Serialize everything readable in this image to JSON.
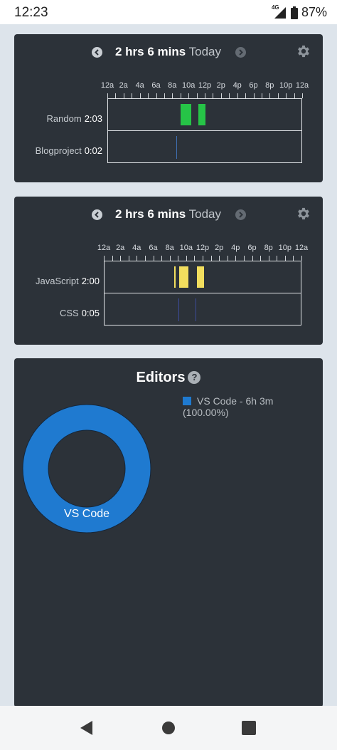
{
  "status": {
    "time": "12:23",
    "network": "4G",
    "battery": "87%"
  },
  "cards": [
    {
      "duration": "2 hrs 6 mins",
      "period": "Today",
      "ticks": [
        "12a",
        "2a",
        "4a",
        "6a",
        "8a",
        "10a",
        "12p",
        "2p",
        "4p",
        "6p",
        "8p",
        "10p",
        "12a"
      ],
      "rows": [
        {
          "name": "Random",
          "time": "2:03",
          "color": "#26c447"
        },
        {
          "name": "Blogproject",
          "time": "0:02",
          "color": "#3f6fb3"
        }
      ]
    },
    {
      "duration": "2 hrs 6 mins",
      "period": "Today",
      "ticks": [
        "12a",
        "2a",
        "4a",
        "6a",
        "8a",
        "10a",
        "12p",
        "2p",
        "4p",
        "6p",
        "8p",
        "10p",
        "12a"
      ],
      "rows": [
        {
          "name": "JavaScript",
          "time": "2:00",
          "color": "#f2de5e"
        },
        {
          "name": "CSS",
          "time": "0:05",
          "color": "#3d4c9c"
        }
      ]
    }
  ],
  "editors": {
    "title": "Editors",
    "help": "?",
    "legend_text": "VS Code - 6h 3m",
    "legend_percent": "(100.00%)",
    "slice_label": "VS Code",
    "color": "#1f7ad0"
  },
  "icons": {
    "prev": "chevron-left-circle-icon",
    "next": "chevron-right-circle-icon",
    "settings": "gear-icon",
    "back": "back-triangle-icon",
    "home": "home-circle-icon",
    "recents": "recents-square-icon"
  }
}
